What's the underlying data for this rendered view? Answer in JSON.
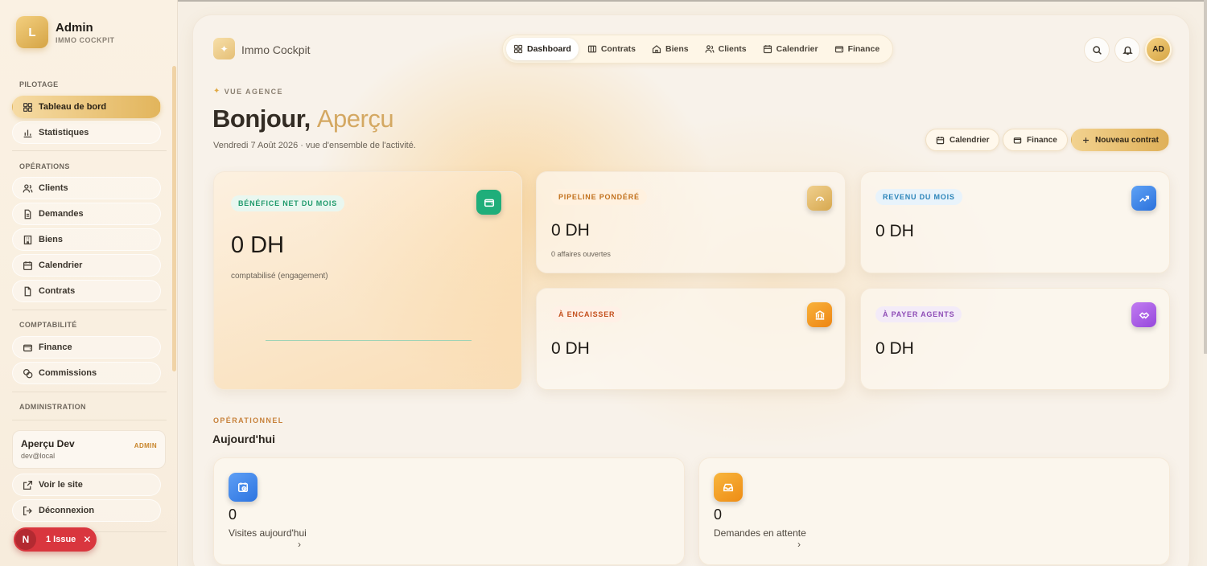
{
  "sidebar": {
    "brand_initial": "L",
    "brand_name": "Admin",
    "brand_sub": "IMMO COCKPIT",
    "sections": [
      {
        "title": "PILOTAGE"
      },
      {
        "title": "OPÉRATIONS"
      },
      {
        "title": "COMPTABILITÉ"
      },
      {
        "title": "ADMINISTRATION"
      }
    ],
    "items": [
      {
        "label": "Tableau de bord",
        "icon": "grid-icon",
        "active": true
      },
      {
        "label": "Statistiques",
        "icon": "bar-chart-icon"
      },
      {
        "label": "Clients",
        "icon": "users-icon"
      },
      {
        "label": "Demandes",
        "icon": "document-icon"
      },
      {
        "label": "Biens",
        "icon": "building-icon"
      },
      {
        "label": "Calendrier",
        "icon": "calendar-icon"
      },
      {
        "label": "Contrats",
        "icon": "file-icon"
      },
      {
        "label": "Finance",
        "icon": "wallet-icon"
      },
      {
        "label": "Commissions",
        "icon": "coins-icon"
      }
    ],
    "user": {
      "name": "Aperçu Dev",
      "email": "dev@local",
      "role": "ADMIN"
    },
    "footer_items": [
      {
        "label": "Voir le site",
        "icon": "external-link-icon"
      },
      {
        "label": "Déconnexion",
        "icon": "logout-icon"
      }
    ],
    "issue_badge": {
      "initial": "N",
      "label": "1 Issue",
      "close": "✕"
    }
  },
  "header": {
    "app_name": "Immo Cockpit",
    "nav": [
      {
        "label": "Dashboard",
        "icon": "grid-icon",
        "active": true
      },
      {
        "label": "Contrats",
        "icon": "contract-icon"
      },
      {
        "label": "Biens",
        "icon": "home-icon"
      },
      {
        "label": "Clients",
        "icon": "users-icon"
      },
      {
        "label": "Calendrier",
        "icon": "calendar-icon"
      },
      {
        "label": "Finance",
        "icon": "wallet-icon"
      }
    ],
    "avatar_initials": "AD"
  },
  "hero": {
    "eyebrow": "VUE AGENCE",
    "greeting": "Bonjour,",
    "greeting_name": "Aperçu",
    "subline": "Vendredi 7 Août 2026 · vue d'ensemble de l'activité.",
    "actions": [
      {
        "label": "Calendrier",
        "icon": "calendar-icon"
      },
      {
        "label": "Finance",
        "icon": "wallet-icon"
      },
      {
        "label": "Nouveau contrat",
        "icon": "plus-icon",
        "primary": true
      }
    ]
  },
  "kpis": [
    {
      "label": "BÉNÉFICE NET DU MOIS",
      "value": "0 DH",
      "note": "comptabilisé (engagement)",
      "color": "#1fae7a",
      "icon": "wallet-icon"
    },
    {
      "label": "PIPELINE PONDÉRÉ",
      "value": "0 DH",
      "note": "0 affaires ouvertes",
      "color": "#e0b35f",
      "icon": "gauge-icon"
    },
    {
      "label": "REVENU DU MOIS",
      "value": "0 DH",
      "color": "#2f7fe6",
      "icon": "trending-up-icon"
    },
    {
      "label": "À ENCAISSER",
      "value": "0 DH",
      "color": "#f0921d",
      "icon": "bank-icon"
    },
    {
      "label": "À PAYER AGENTS",
      "value": "0 DH",
      "color": "#a559e2",
      "icon": "handshake-icon"
    }
  ],
  "operational": {
    "eyebrow": "OPÉRATIONNEL",
    "title": "Aujourd'hui",
    "cards": [
      {
        "value": "0",
        "label": "Visites aujourd'hui",
        "icon": "calendar-clock-icon",
        "color": "#3585ee"
      },
      {
        "value": "0",
        "label": "Demandes en attente",
        "icon": "inbox-icon",
        "color": "#f2a01e"
      }
    ]
  }
}
